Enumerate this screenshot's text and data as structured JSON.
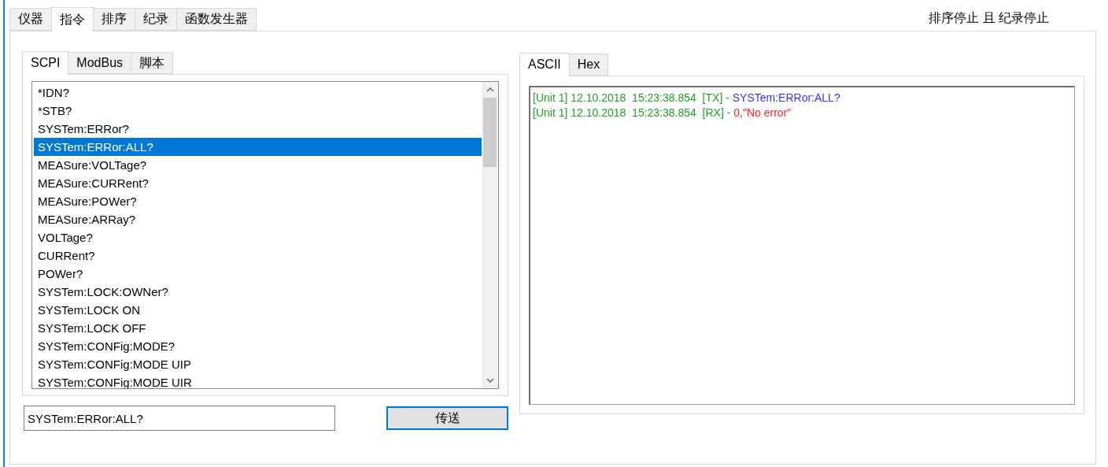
{
  "main_tabs": [
    {
      "label": "仪器",
      "selected": false
    },
    {
      "label": "指令",
      "selected": true
    },
    {
      "label": "排序",
      "selected": false
    },
    {
      "label": "纪录",
      "selected": false
    },
    {
      "label": "函数发生器",
      "selected": false
    }
  ],
  "status": "排序停止 且 纪录停止",
  "command_tabs": [
    {
      "label": "SCPI",
      "selected": true
    },
    {
      "label": "ModBus",
      "selected": false
    },
    {
      "label": "脚本",
      "selected": false
    }
  ],
  "commands": [
    {
      "label": "*IDN?",
      "selected": false
    },
    {
      "label": "*STB?",
      "selected": false
    },
    {
      "label": "SYSTem:ERRor?",
      "selected": false
    },
    {
      "label": "SYSTem:ERRor:ALL?",
      "selected": true
    },
    {
      "label": "MEASure:VOLTage?",
      "selected": false
    },
    {
      "label": "MEASure:CURRent?",
      "selected": false
    },
    {
      "label": "MEASure:POWer?",
      "selected": false
    },
    {
      "label": "MEASure:ARRay?",
      "selected": false
    },
    {
      "label": "VOLTage?",
      "selected": false
    },
    {
      "label": "CURRent?",
      "selected": false
    },
    {
      "label": "POWer?",
      "selected": false
    },
    {
      "label": "SYSTem:LOCK:OWNer?",
      "selected": false
    },
    {
      "label": "SYSTem:LOCK ON",
      "selected": false
    },
    {
      "label": "SYSTem:LOCK OFF",
      "selected": false
    },
    {
      "label": "SYSTem:CONFig:MODE?",
      "selected": false
    },
    {
      "label": "SYSTem:CONFig:MODE UIP",
      "selected": false
    },
    {
      "label": "SYSTem:CONFig:MODE UIR",
      "selected": false
    }
  ],
  "command_input": {
    "value": "SYSTem:ERRor:ALL?"
  },
  "send_button": "传送",
  "log_tabs": [
    {
      "label": "ASCII",
      "selected": true
    },
    {
      "label": "Hex",
      "selected": false
    }
  ],
  "log": [
    {
      "prefix": "[Unit 1] 12.10.2018  15:23:38.854  [TX] - ",
      "message": "SYSTem:ERRor:ALL?",
      "kind": "tx"
    },
    {
      "prefix": "[Unit 1] 12.10.2018  15:23:38.854  [RX] - ",
      "message": "0,\"No error\"",
      "kind": "rx"
    }
  ]
}
